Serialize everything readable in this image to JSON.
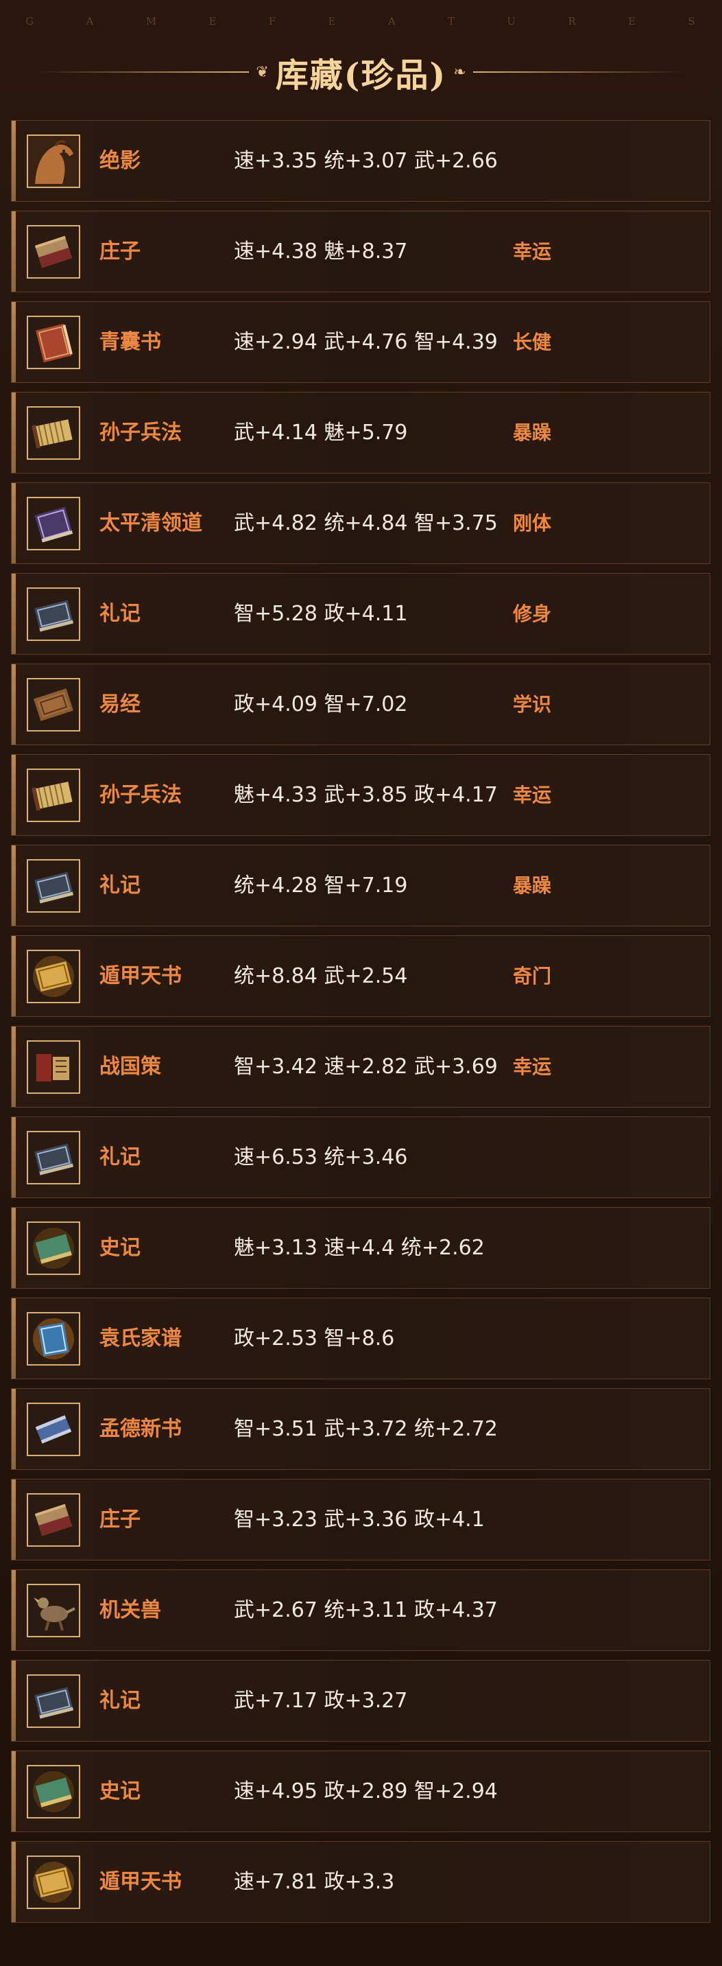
{
  "header": {
    "subtitle_letters": [
      "G",
      "A",
      "M",
      "E",
      "F",
      "E",
      "A",
      "T",
      "U",
      "R",
      "E",
      "S"
    ],
    "title": "库藏(珍品)"
  },
  "items": [
    {
      "name": "绝影",
      "stats": "速+3.35 统+3.07 武+2.66",
      "trait": "",
      "icon": "horse-icon"
    },
    {
      "name": "庄子",
      "stats": "速+4.38 魅+8.37",
      "trait": "幸运",
      "icon": "scroll-book-icon"
    },
    {
      "name": "青囊书",
      "stats": "速+2.94 武+4.76 智+4.39",
      "trait": "长健",
      "icon": "red-book-icon"
    },
    {
      "name": "孙子兵法",
      "stats": "武+4.14 魅+5.79",
      "trait": "暴躁",
      "icon": "bamboo-slip-icon"
    },
    {
      "name": "太平清领道",
      "stats": "武+4.82 统+4.84 智+3.75",
      "trait": "刚体",
      "icon": "purple-book-icon"
    },
    {
      "name": "礼记",
      "stats": "智+5.28 政+4.11",
      "trait": "修身",
      "icon": "dark-book-icon"
    },
    {
      "name": "易经",
      "stats": "政+4.09 智+7.02",
      "trait": "学识",
      "icon": "wood-board-icon"
    },
    {
      "name": "孙子兵法",
      "stats": "魅+4.33 武+3.85 政+4.17",
      "trait": "幸运",
      "icon": "bamboo-slip-icon"
    },
    {
      "name": "礼记",
      "stats": "统+4.28 智+7.19",
      "trait": "暴躁",
      "icon": "dark-book-icon"
    },
    {
      "name": "遁甲天书",
      "stats": "统+8.84 武+2.54",
      "trait": "奇门",
      "icon": "golden-book-icon"
    },
    {
      "name": "战国策",
      "stats": "智+3.42 速+2.82 武+3.69",
      "trait": "幸运",
      "icon": "scroll-stack-icon"
    },
    {
      "name": "礼记",
      "stats": "速+6.53 统+3.46",
      "trait": "",
      "icon": "dark-book-icon"
    },
    {
      "name": "史记",
      "stats": "魅+3.13 速+4.4 统+2.62",
      "trait": "",
      "icon": "green-book-icon"
    },
    {
      "name": "袁氏家谱",
      "stats": "政+2.53 智+8.6",
      "trait": "",
      "icon": "blue-book-icon"
    },
    {
      "name": "孟德新书",
      "stats": "智+3.51 武+3.72 统+2.72",
      "trait": "",
      "icon": "blue-scroll-icon"
    },
    {
      "name": "庄子",
      "stats": "智+3.23 武+3.36 政+4.1",
      "trait": "",
      "icon": "scroll-book-icon"
    },
    {
      "name": "机关兽",
      "stats": "武+2.67 统+3.11 政+4.37",
      "trait": "",
      "icon": "mechanical-beast-icon"
    },
    {
      "name": "礼记",
      "stats": "武+7.17 政+3.27",
      "trait": "",
      "icon": "dark-book-icon"
    },
    {
      "name": "史记",
      "stats": "速+4.95 政+2.89 智+2.94",
      "trait": "",
      "icon": "green-book-icon"
    },
    {
      "name": "遁甲天书",
      "stats": "速+7.81 政+3.3",
      "trait": "",
      "icon": "golden-book-icon"
    }
  ]
}
